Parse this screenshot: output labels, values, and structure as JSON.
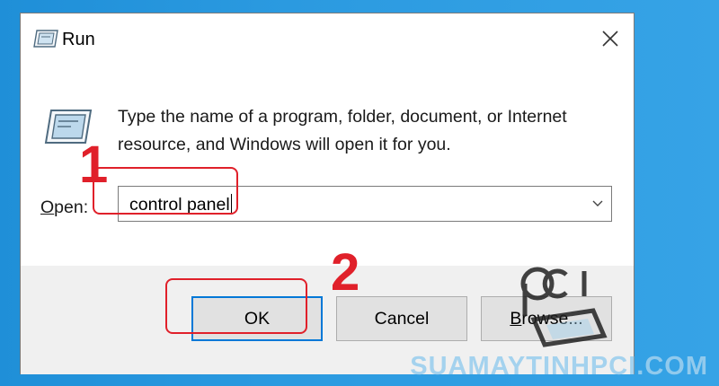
{
  "dialog": {
    "title": "Run",
    "description": "Type the name of a program, folder, document, or Internet resource, and Windows will open it for you.",
    "open_label_mnemonic": "O",
    "open_label_rest": "pen:",
    "open_value": "control panel",
    "buttons": {
      "ok": "OK",
      "cancel": "Cancel",
      "browse_mnemonic": "B",
      "browse_rest": "rowse..."
    }
  },
  "annotations": {
    "step1": "1",
    "step2": "2",
    "highlight_color": "#e0202a"
  },
  "watermark": {
    "text": "SUAMAYTINHPCI.COM"
  },
  "icons": {
    "title": "run-app-icon",
    "content": "run-app-icon-large",
    "close": "close-icon",
    "dropdown": "chevron-down-icon",
    "logo": "pci-logo"
  },
  "colors": {
    "desktop": "#2b9ae0",
    "accent": "#0078d7",
    "footer": "#f0f0f0"
  }
}
